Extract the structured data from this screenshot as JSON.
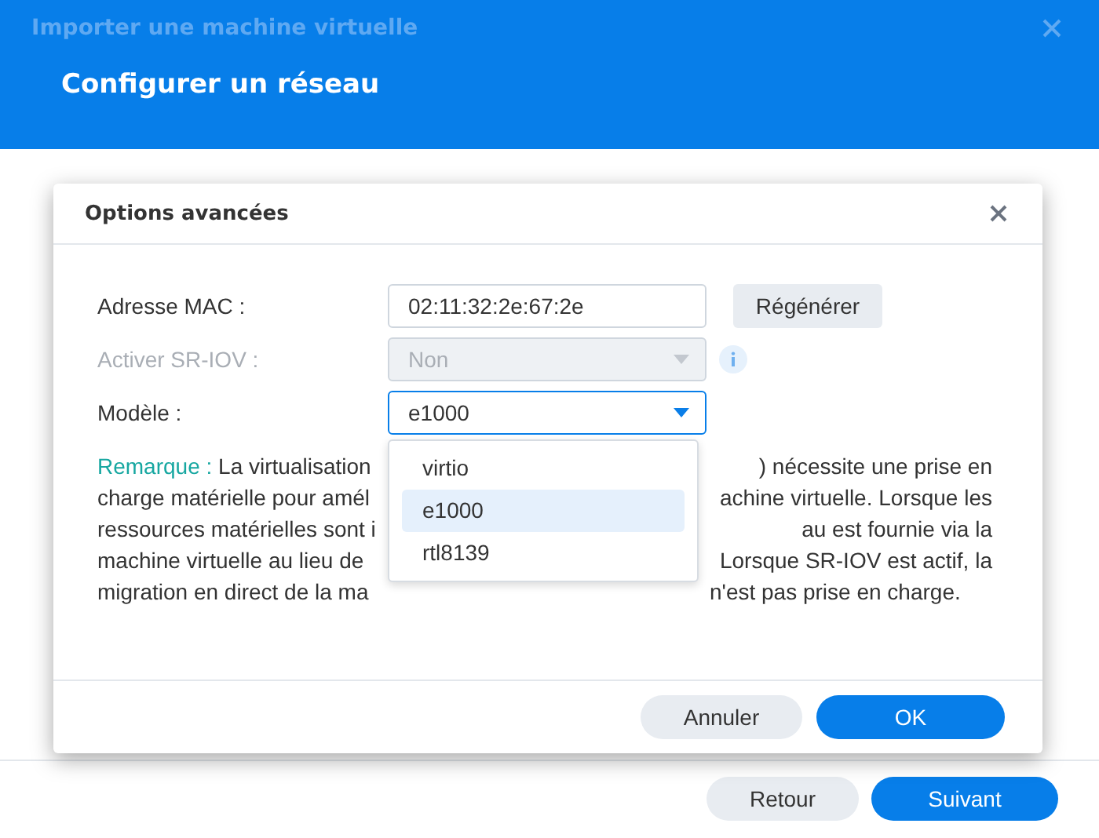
{
  "window": {
    "title": "Importer une machine virtuelle"
  },
  "page": {
    "heading": "Configurer un réseau"
  },
  "dialog": {
    "title": "Options avancées",
    "fields": [
      {
        "kind": "text",
        "label": "Adresse MAC :",
        "value": "02:11:32:2e:67:2e",
        "disabled": false,
        "button": "Régénérer"
      },
      {
        "kind": "select",
        "label": "Activer SR-IOV :",
        "value": "Non",
        "disabled": true,
        "info": true
      },
      {
        "kind": "select",
        "label": "Modèle :",
        "value": "e1000",
        "disabled": false,
        "expanded": true,
        "options": [
          {
            "label": "virtio",
            "selected": false
          },
          {
            "label": "e1000",
            "selected": true
          },
          {
            "label": "rtl8139",
            "selected": false
          }
        ]
      }
    ],
    "note": {
      "label": "Remarque :",
      "lines": [
        {
          "left": "La virtualisation",
          "right": ") nécessite une prise en"
        },
        {
          "left": "charge matérielle pour amél",
          "right": "achine virtuelle. Lorsque les"
        },
        {
          "left": "ressources matérielles sont i",
          "right": "au est fournie via la"
        },
        {
          "left": "machine virtuelle au lieu de",
          "right": "Lorsque SR-IOV est actif, la"
        },
        {
          "left": "migration en direct de la ma",
          "right": "n'est pas prise en charge."
        }
      ]
    },
    "buttons": [
      {
        "label": "Annuler",
        "kind": "secondary"
      },
      {
        "label": "OK",
        "kind": "primary"
      }
    ]
  },
  "page_buttons": [
    {
      "label": "Retour",
      "kind": "secondary"
    },
    {
      "label": "Suivant",
      "kind": "primary"
    }
  ]
}
